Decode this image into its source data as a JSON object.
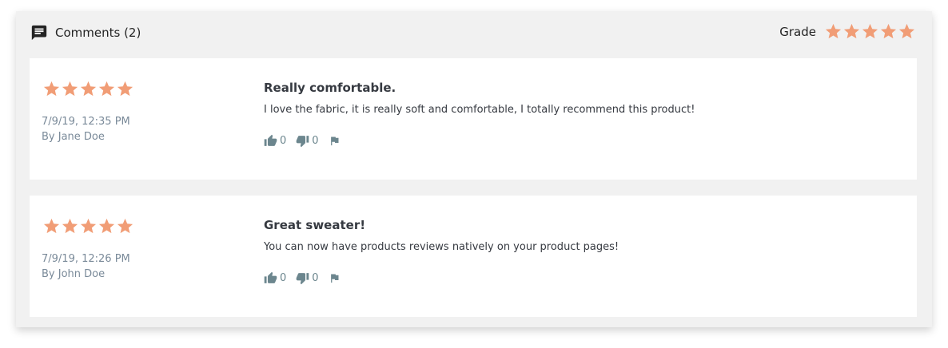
{
  "header": {
    "title": "Comments (2)",
    "grade_label": "Grade",
    "grade_rating": 5,
    "grade_max": 5
  },
  "colors": {
    "star": "#f19d76",
    "icon": "#6c868e",
    "meta_text": "#7a8a99",
    "body_text": "#363a41"
  },
  "comments": [
    {
      "rating": 5,
      "date": "7/9/19, 12:35 PM",
      "author": "By Jane Doe",
      "title": "Really comfortable.",
      "body": "I love the fabric, it is really soft and comfortable, I totally recommend this product!",
      "useful_count": "0",
      "not_useful_count": "0"
    },
    {
      "rating": 5,
      "date": "7/9/19, 12:26 PM",
      "author": "By John Doe",
      "title": "Great sweater!",
      "body": "You can now have products reviews natively on your product pages!",
      "useful_count": "0",
      "not_useful_count": "0"
    }
  ],
  "icons": {
    "header": "comment-icon",
    "star": "star-icon",
    "useful": "thumb-up-icon",
    "not_useful": "thumb-down-icon",
    "report": "flag-icon"
  }
}
